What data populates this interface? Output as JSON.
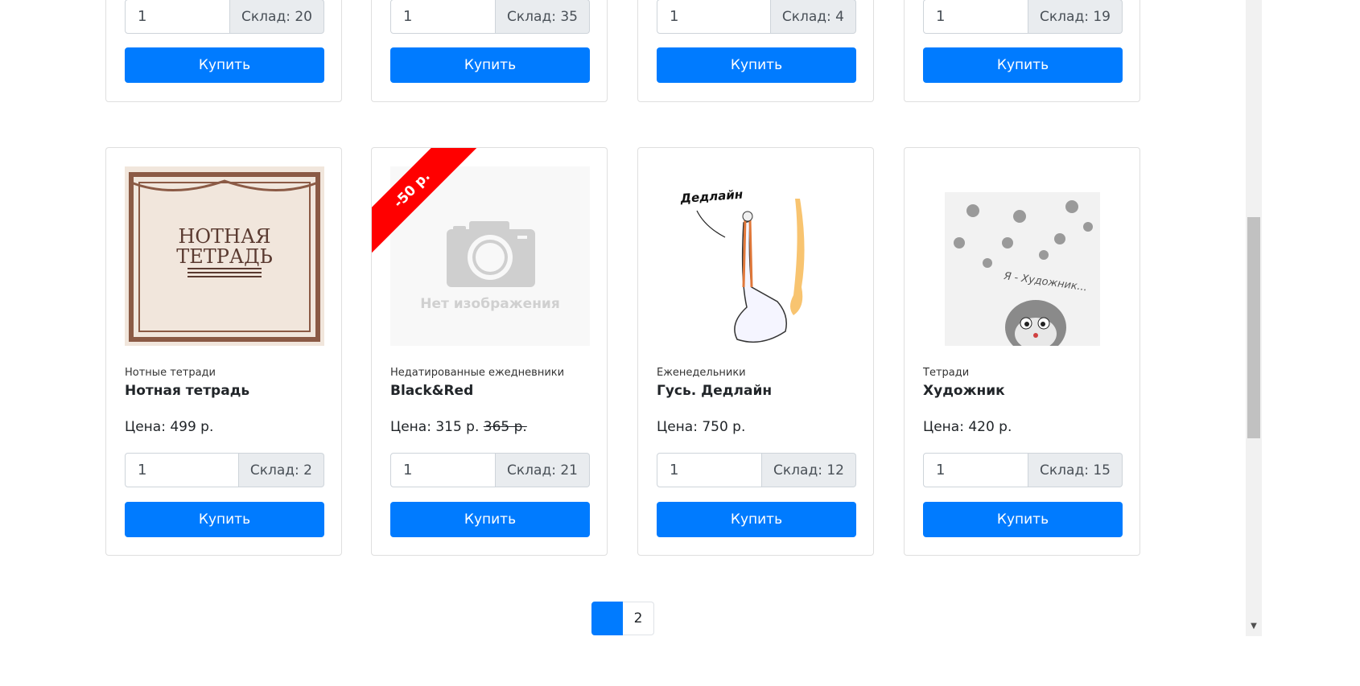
{
  "top_row": [
    {
      "qty": "1",
      "stock": "Склад: 20",
      "buy": "Купить"
    },
    {
      "qty": "1",
      "stock": "Склад: 35",
      "buy": "Купить"
    },
    {
      "qty": "1",
      "stock": "Склад: 4",
      "buy": "Купить"
    },
    {
      "qty": "1",
      "stock": "Склад: 19",
      "buy": "Купить"
    }
  ],
  "products": [
    {
      "category": "Нотные тетради",
      "title": "Нотная тетрадь",
      "price": "Цена: 499 р.",
      "qty": "1",
      "stock": "Склад: 2",
      "buy": "Купить",
      "cover_line1": "НОТНАЯ",
      "cover_line2": "ТЕТРАДЬ"
    },
    {
      "category": "Недатированные ежедневники",
      "title": "Black&Red",
      "price": "Цена: 315 р.",
      "old_price": "365 р.",
      "discount": "-50 р.",
      "no_image_text": "Нет изображения",
      "qty": "1",
      "stock": "Склад: 21",
      "buy": "Купить"
    },
    {
      "category": "Еженедельники",
      "title": "Гусь. Дедлайн",
      "price": "Цена: 750 р.",
      "image_caption": "Дедлайн",
      "qty": "1",
      "stock": "Склад: 12",
      "buy": "Купить"
    },
    {
      "category": "Тетради",
      "title": "Художник",
      "price": "Цена: 420 р.",
      "image_caption": "Я - Художник...",
      "qty": "1",
      "stock": "Склад: 15",
      "buy": "Купить"
    }
  ],
  "pagination": {
    "active": "",
    "page2": "2"
  },
  "colors": {
    "primary": "#007bff",
    "ribbon": "#ff0000",
    "addon_bg": "#e9ecef"
  }
}
